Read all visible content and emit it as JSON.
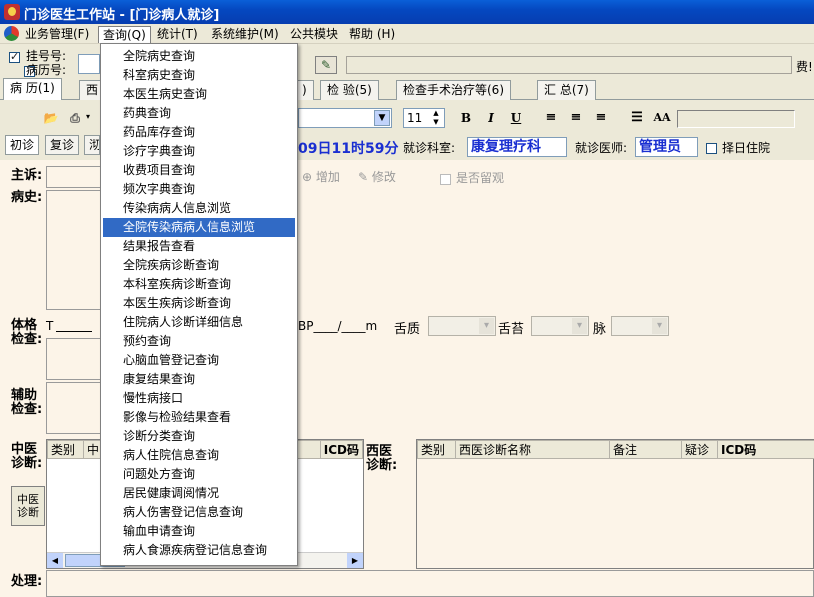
{
  "window": {
    "title": "门诊医生工作站 - [门诊病人就诊]"
  },
  "menubar": [
    {
      "label": "业务管理(F)"
    },
    {
      "label": "查询(Q)"
    },
    {
      "label": "统计(T)"
    },
    {
      "label": "系统维护(M)"
    },
    {
      "label": "公共模块"
    },
    {
      "label": "帮助 (H)"
    }
  ],
  "patient": {
    "reg_no_label": "挂号号:",
    "record_no_label": "病历号:",
    "fee_label": "费!",
    "reg_checked": true,
    "record_checked": false
  },
  "tabs": [
    {
      "label": "病 历(1)"
    },
    {
      "label": "西"
    },
    {
      "label": ")"
    },
    {
      "label": "检 验(5)"
    },
    {
      "label": "检查手术治疗等(6)"
    },
    {
      "label": "汇 总(7)"
    }
  ],
  "toolbar": {
    "font_size": "11",
    "bold": "B",
    "italic": "I",
    "underline": "U",
    "case_btn": "AA"
  },
  "visit": {
    "first_visit": "初诊",
    "follow_up": "复诊",
    "partial_tab": "沏",
    "time_text": "09日11时59分",
    "dept_label": "就诊科室:",
    "dept_value": "康复理疗科",
    "doctor_label": "就诊医师:",
    "doctor_value": "管理员",
    "hosp_choice": "择日住院"
  },
  "form": {
    "complaint_label": "主诉:",
    "history_label": "病史:",
    "add_label": "增加",
    "modify_label": "修改",
    "keep_label": "是否留观",
    "exam_label1": "体格",
    "exam_label2": "检查:",
    "exam_t": "T",
    "exam_bp": "BP____/____m",
    "tongue_label": "舌质",
    "coating_label": "舌苔",
    "pulse_label": "脉",
    "aux_label1": "辅助",
    "aux_label2": "检查:",
    "tcm_label1": "中医",
    "tcm_label2": "诊断:",
    "tcm_button1": "中医",
    "tcm_button2": "诊断",
    "west_label1": "西医",
    "west_label2": "诊断:",
    "treat_label": "处理:",
    "tcm_cols": [
      "类别",
      "中",
      "",
      "",
      "",
      "ICD码"
    ],
    "west_cols": [
      "类别",
      "西医诊断名称",
      "备注",
      "疑诊",
      "ICD码"
    ]
  },
  "dropdown": {
    "highlight_index": 9,
    "items": [
      "全院病史查询",
      "科室病史查询",
      "本医生病史查询",
      "药典查询",
      "药品库存查询",
      "诊疗字典查询",
      "收费项目查询",
      "频次字典查询",
      "传染病病人信息浏览",
      "全院传染病病人信息浏览",
      "结果报告查看",
      "全院疾病诊断查询",
      "本科室疾病诊断查询",
      "本医生疾病诊断查询",
      "住院病人诊断详细信息",
      "预约查询",
      "心脑血管登记查询",
      "康复结果查询",
      "慢性病接口",
      "影像与检验结果查看",
      "诊断分类查询",
      "病人住院信息查询",
      "问题处方查询",
      "居民健康调阅情况",
      "病人伤害登记信息查询",
      "输血申请查询",
      "病人食源疾病登记信息查询"
    ]
  }
}
